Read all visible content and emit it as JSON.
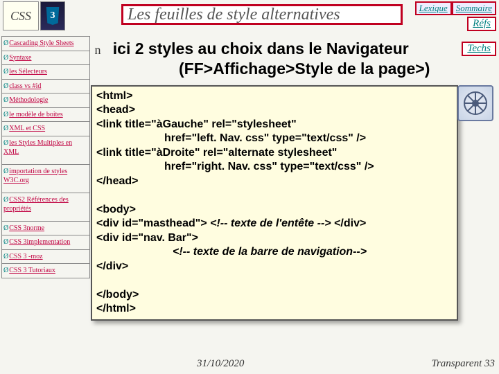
{
  "topbar": {
    "lexique": "Lexique",
    "sommaire": "Sommaire"
  },
  "refs": "Réfs",
  "techs": "Techs",
  "logo": {
    "css": "CSS",
    "three": "3"
  },
  "title": "Les feuilles de style alternatives",
  "sidebar": [
    "Cascading Style Sheets",
    "Syntaxe",
    "les Sélecteurs",
    "class vs #id",
    "Méthodologie",
    "le modèle de boites",
    "XML et CSS",
    "les Styles Multiples en XML",
    "importation de styles W3C.org",
    "CSS2  Références des propriétés",
    "CSS 3norme",
    "CSS 3implementation",
    "CSS 3 -moz",
    "CSS 3 Tutoriaux"
  ],
  "heading": {
    "bullet": "n",
    "line1": "ici 2 styles au choix dans le Navigateur",
    "line2": "(FF>Affichage>Style de la page>)"
  },
  "code": {
    "l0": "<html>",
    "l1": "<head>",
    "l2": "<link title=\"àGauche\" rel=\"stylesheet\"",
    "l3": "href=\"left. Nav. css\" type=\"text/css\" />",
    "l4": "<link title=\"àDroite\"  rel=\"alternate stylesheet\"",
    "l5": "href=\"right. Nav. css\" type=\"text/css\" />",
    "l6": "</head>",
    "sp": " ",
    "l7": "<body>",
    "l8a": "<div id=\"masthead\"> ",
    "l8b": "<!-- texte de l'entête  -->",
    "l8c": " </div>",
    "l9": "<div id=\"nav. Bar\">",
    "l10": "<!-- texte de la barre de navigation-->",
    "l11": "</div>",
    "l12": "</body>",
    "l13": "</html>"
  },
  "footer": {
    "date": "31/10/2020",
    "num": "Transparent 33"
  }
}
